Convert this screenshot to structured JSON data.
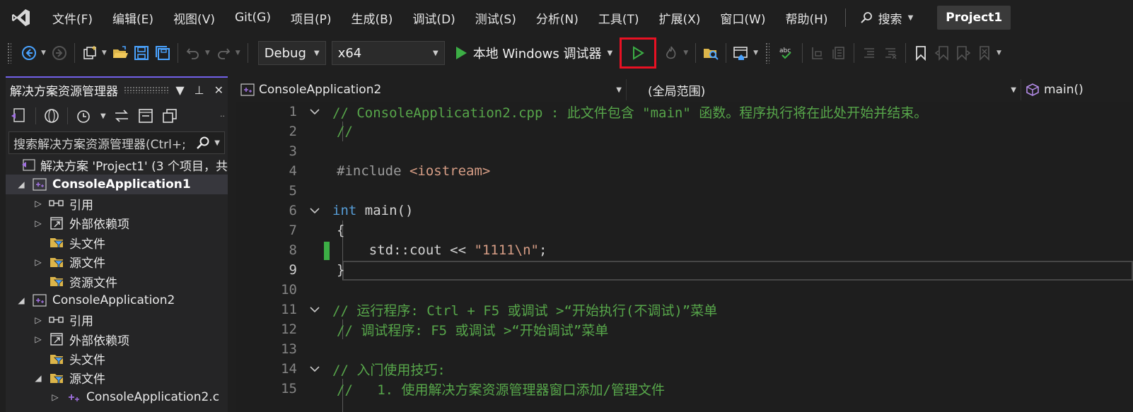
{
  "menubar": {
    "items": [
      "文件(F)",
      "编辑(E)",
      "视图(V)",
      "Git(G)",
      "项目(P)",
      "生成(B)",
      "调试(D)",
      "测试(S)",
      "分析(N)",
      "工具(T)",
      "扩展(X)",
      "窗口(W)",
      "帮助(H)"
    ],
    "search_label": "搜索",
    "project_name": "Project1"
  },
  "toolbar": {
    "config": "Debug",
    "platform": "x64",
    "run_label": "本地 Windows 调试器"
  },
  "solution_explorer": {
    "title": "解决方案资源管理器",
    "search_placeholder": "搜索解决方案资源管理器(Ctrl+;",
    "tree": [
      {
        "label": "解决方案 'Project1' (3 个项目，共",
        "indent": 0,
        "icon": "solution-icon",
        "expander": ""
      },
      {
        "label": "ConsoleApplication1",
        "indent": 1,
        "icon": "cpp-project-icon",
        "expander": "expanded",
        "bold": true,
        "selected": true
      },
      {
        "label": "引用",
        "indent": 2,
        "icon": "references-icon",
        "expander": "collapsed"
      },
      {
        "label": "外部依赖项",
        "indent": 2,
        "icon": "external-deps-icon",
        "expander": "collapsed"
      },
      {
        "label": "头文件",
        "indent": 2,
        "icon": "filter-folder-icon",
        "expander": ""
      },
      {
        "label": "源文件",
        "indent": 2,
        "icon": "filter-folder-icon",
        "expander": "collapsed"
      },
      {
        "label": "资源文件",
        "indent": 2,
        "icon": "filter-folder-icon",
        "expander": ""
      },
      {
        "label": "ConsoleApplication2",
        "indent": 1,
        "icon": "cpp-project-icon",
        "expander": "expanded"
      },
      {
        "label": "引用",
        "indent": 2,
        "icon": "references-icon",
        "expander": "collapsed"
      },
      {
        "label": "外部依赖项",
        "indent": 2,
        "icon": "external-deps-icon",
        "expander": "collapsed"
      },
      {
        "label": "头文件",
        "indent": 2,
        "icon": "filter-folder-icon",
        "expander": ""
      },
      {
        "label": "源文件",
        "indent": 2,
        "icon": "filter-folder-icon",
        "expander": "expanded"
      },
      {
        "label": "ConsoleApplication2.c",
        "indent": 3,
        "icon": "cpp-file-icon",
        "expander": "collapsed"
      }
    ]
  },
  "editor_nav": {
    "project": "ConsoleApplication2",
    "scope": "(全局范围)",
    "member": "main()"
  },
  "editor": {
    "current_line": 9,
    "lines": [
      {
        "n": "1",
        "fold": true,
        "tokens": [
          {
            "t": "// ConsoleApplication2.cpp : 此文件包含 \"main\" 函数。程序执行将在此处开始并结束。",
            "c": "c-comment"
          }
        ]
      },
      {
        "n": "2",
        "tokens": [
          {
            "t": "//",
            "c": "c-comment"
          }
        ]
      },
      {
        "n": "3",
        "tokens": []
      },
      {
        "n": "4",
        "tokens": [
          {
            "t": "#include ",
            "c": "c-pre"
          },
          {
            "t": "<iostream>",
            "c": "c-inc"
          }
        ]
      },
      {
        "n": "5",
        "tokens": []
      },
      {
        "n": "6",
        "fold": true,
        "tokens": [
          {
            "t": "int",
            "c": "c-keyword"
          },
          {
            "t": " main()",
            "c": ""
          }
        ]
      },
      {
        "n": "7",
        "tokens": [
          {
            "t": "{",
            "c": ""
          }
        ]
      },
      {
        "n": "8",
        "tokens": [
          {
            "t": "    std::cout << ",
            "c": ""
          },
          {
            "t": "\"1111\\n\"",
            "c": "c-string"
          },
          {
            "t": ";",
            "c": ""
          }
        ]
      },
      {
        "n": "9",
        "tokens": [
          {
            "t": "}",
            "c": ""
          }
        ]
      },
      {
        "n": "10",
        "tokens": []
      },
      {
        "n": "11",
        "fold": true,
        "tokens": [
          {
            "t": "// 运行程序: Ctrl + F5 或调试 >“开始执行(不调试)”菜单",
            "c": "c-comment"
          }
        ]
      },
      {
        "n": "12",
        "tokens": [
          {
            "t": "// 调试程序: F5 或调试 >“开始调试”菜单",
            "c": "c-comment"
          }
        ]
      },
      {
        "n": "13",
        "tokens": []
      },
      {
        "n": "14",
        "fold": true,
        "tokens": [
          {
            "t": "// 入门使用技巧: ",
            "c": "c-comment"
          }
        ]
      },
      {
        "n": "15",
        "tokens": [
          {
            "t": "//   1. 使用解决方案资源管理器窗口添加/管理文件",
            "c": "c-comment"
          }
        ]
      }
    ]
  },
  "colors": {
    "accent": "#7160e8",
    "run_green": "#3cae45",
    "highlight_red": "#e81123"
  }
}
